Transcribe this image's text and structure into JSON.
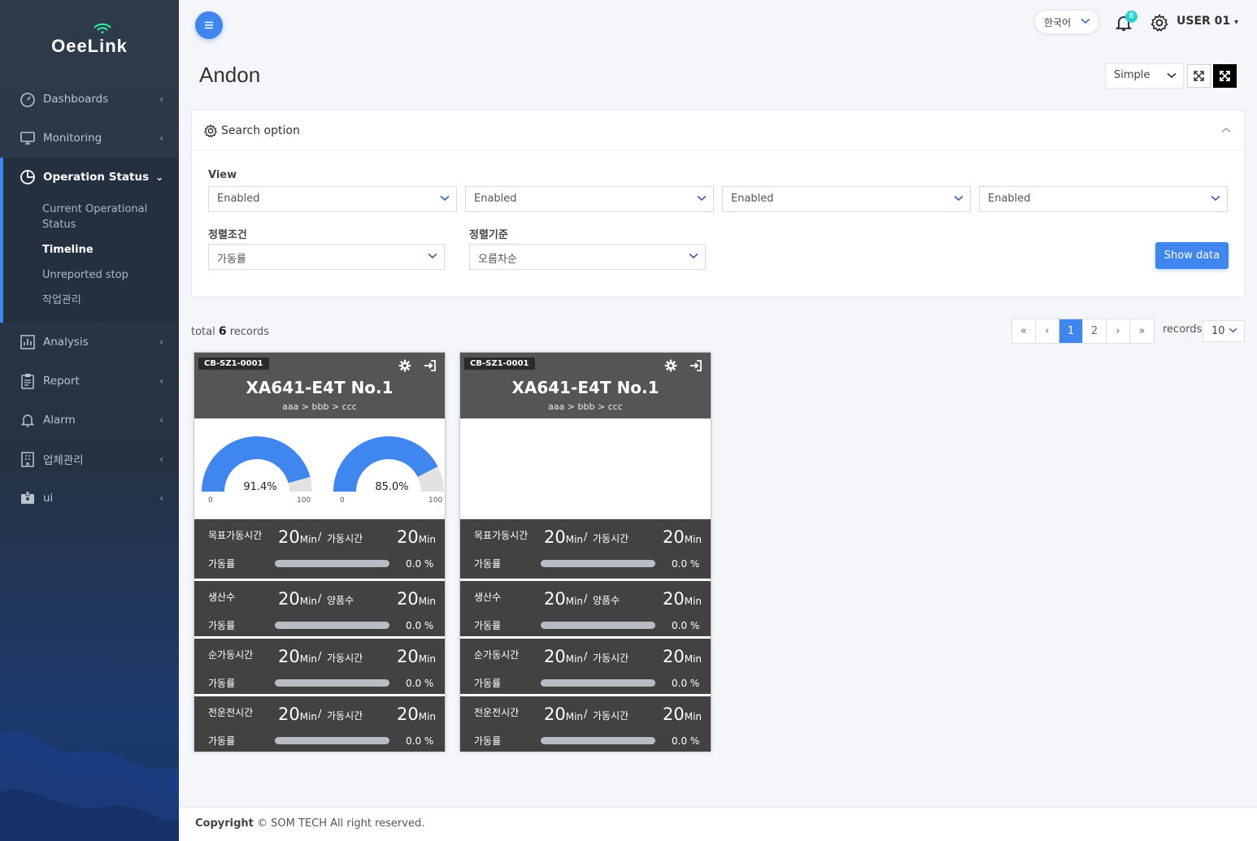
{
  "app": {
    "logo": "OeeLink"
  },
  "sidebar": {
    "items": [
      {
        "label": "Dashboards",
        "icon": "gauge-icon"
      },
      {
        "label": "Monitoring",
        "icon": "monitor-icon"
      }
    ],
    "group": {
      "label": "Operation Status",
      "icon": "pie-chart-icon",
      "subitems": [
        {
          "label": "Current Operational Status"
        },
        {
          "label": "Timeline"
        },
        {
          "label": "Unreported stop"
        },
        {
          "label": "작업관리"
        }
      ]
    },
    "items2": [
      {
        "label": "Analysis",
        "icon": "bar-chart-icon"
      },
      {
        "label": "Report",
        "icon": "clipboard-icon"
      },
      {
        "label": "Alarm",
        "icon": "bell-icon"
      },
      {
        "label": "업체관리",
        "icon": "building-icon"
      },
      {
        "label": "ui",
        "icon": "badge-icon"
      }
    ]
  },
  "topbar": {
    "language": "한국어",
    "notification_count": "8",
    "user": "USER 01"
  },
  "page": {
    "title": "Andon",
    "mode": "Simple"
  },
  "search": {
    "title": "Search option",
    "view_label": "View",
    "view_selects": [
      "Enabled",
      "Enabled",
      "Enabled",
      "Enabled"
    ],
    "sort_cond_label": "정렬조건",
    "sort_cond_value": "가동률",
    "sort_order_label": "정렬기준",
    "sort_order_value": "오름차순",
    "show_button": "Show data"
  },
  "records": {
    "total_prefix": "total",
    "total": "6",
    "total_suffix": "records",
    "pages": [
      "«",
      "‹",
      "1",
      "2",
      "›",
      "»"
    ],
    "current_page": "1",
    "per_page_label": "records",
    "per_page": "10"
  },
  "cards": [
    {
      "tag": "CB-SZ1-0001",
      "title": "XA641-E4T No.1",
      "path": "aaa > bbb > ccc",
      "gauges": [
        {
          "value": 91.4,
          "label": "91.4%",
          "min": "0",
          "max": "100"
        },
        {
          "value": 85.0,
          "label": "85.0%",
          "min": "0",
          "max": "100"
        }
      ],
      "stats": [
        {
          "label1": "목표가동시간",
          "value1": "20",
          "unit1": "Min",
          "label2": "가동시간",
          "value2": "20",
          "unit2": "Min",
          "rate_label": "가동률",
          "rate": 0.0,
          "rate_text": "0.0 %"
        },
        {
          "label1": "생산수",
          "value1": "20",
          "unit1": "Min",
          "label2": "양품수",
          "value2": "20",
          "unit2": "Min",
          "rate_label": "가동률",
          "rate": 0.0,
          "rate_text": "0.0 %"
        },
        {
          "label1": "순가동시간",
          "value1": "20",
          "unit1": "Min",
          "label2": "가동시간",
          "value2": "20",
          "unit2": "Min",
          "rate_label": "가동률",
          "rate": 0.0,
          "rate_text": "0.0 %"
        },
        {
          "label1": "전운전시간",
          "value1": "20",
          "unit1": "Min",
          "label2": "가동시간",
          "value2": "20",
          "unit2": "Min",
          "rate_label": "가동률",
          "rate": 0.0,
          "rate_text": "0.0 %"
        }
      ]
    },
    {
      "tag": "CB-SZ1-0001",
      "title": "XA641-E4T No.1",
      "path": "aaa > bbb > ccc",
      "gauges": [],
      "stats": [
        {
          "label1": "목표가동시간",
          "value1": "20",
          "unit1": "Min",
          "label2": "가동시간",
          "value2": "20",
          "unit2": "Min",
          "rate_label": "가동률",
          "rate": 0.0,
          "rate_text": "0.0 %"
        },
        {
          "label1": "생산수",
          "value1": "20",
          "unit1": "Min",
          "label2": "양품수",
          "value2": "20",
          "unit2": "Min",
          "rate_label": "가동률",
          "rate": 0.0,
          "rate_text": "0.0 %"
        },
        {
          "label1": "순가동시간",
          "value1": "20",
          "unit1": "Min",
          "label2": "가동시간",
          "value2": "20",
          "unit2": "Min",
          "rate_label": "가동률",
          "rate": 0.0,
          "rate_text": "0.0 %"
        },
        {
          "label1": "전운전시간",
          "value1": "20",
          "unit1": "Min",
          "label2": "가동시간",
          "value2": "20",
          "unit2": "Min",
          "rate_label": "가동률",
          "rate": 0.0,
          "rate_text": "0.0 %"
        }
      ]
    }
  ],
  "footer": {
    "bold": "Copyright",
    "text": "© SOM TECH All right reserved."
  },
  "colors": {
    "accent": "#3f86ee",
    "card_head": "#555555",
    "stat_bg": "#424242",
    "badge": "#2cd4d0"
  }
}
